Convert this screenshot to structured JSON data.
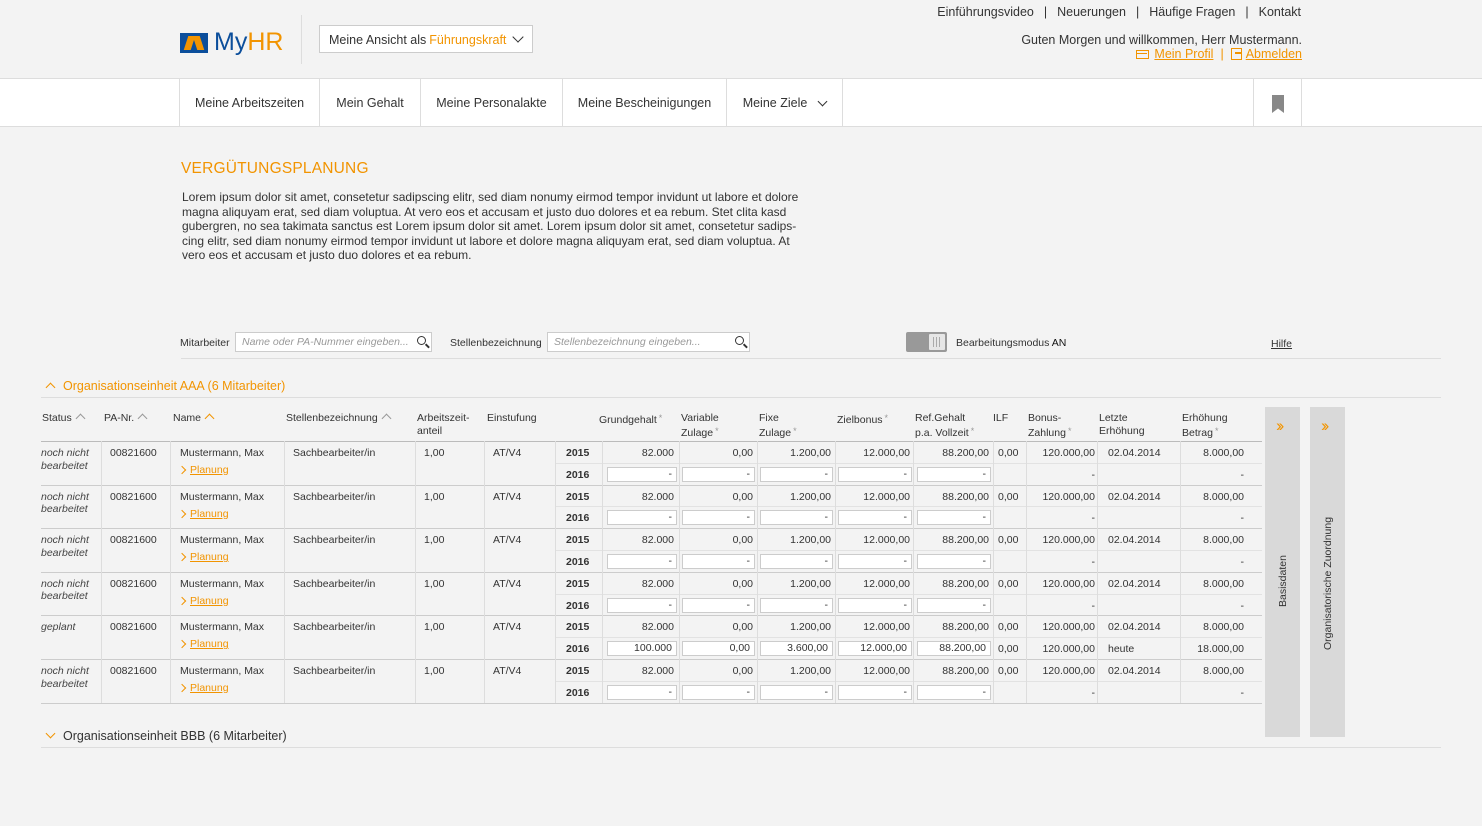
{
  "header": {
    "logo_text_my": "My",
    "logo_text_hr": "HR",
    "view_label": "Meine Ansicht als",
    "view_value": "Führungskraft",
    "top_links": [
      "Einführungsvideo",
      "Neuerungen",
      "Häufige Fragen",
      "Kontakt"
    ],
    "greeting": "Guten Morgen und willkommen, Herr Mustermann.",
    "profile_link": "Mein Profil",
    "logout_link": "Abmelden"
  },
  "nav": {
    "items": [
      "Meine Arbeitszeiten",
      "Mein Gehalt",
      "Meine Personalakte",
      "Meine Bescheinigungen",
      "Meine Ziele"
    ]
  },
  "page": {
    "title": "VERGÜTUNGSPLANUNG",
    "intro_lines": [
      "Lorem ipsum dolor sit amet, consetetur sadipscing elitr, sed diam nonumy eirmod tempor invidunt ut labore et dolore",
      "magna aliquyam erat, sed diam voluptua. At vero eos et accusam et justo duo dolores et ea rebum. Stet clita kasd",
      "gubergren, no sea takimata sanctus est Lorem ipsum dolor sit amet. Lorem ipsum dolor sit amet, consetetur sadips-",
      "cing elitr, sed diam nonumy eirmod tempor invidunt ut labore et dolore magna aliquyam erat, sed diam voluptua. At",
      "vero eos et accusam et justo duo dolores et ea rebum."
    ]
  },
  "filter": {
    "employee_label": "Mitarbeiter",
    "employee_placeholder": "Name oder PA-Nummer eingeben...",
    "position_label": "Stellenbezeichnung",
    "position_placeholder": "Stellenbezeichnung eingeben...",
    "edit_mode_label": "Bearbeitungsmodus",
    "edit_mode_value": "AN",
    "help_link": "Hilfe"
  },
  "org_units": [
    {
      "label": "Organisationseinheit AAA (6 Mitarbeiter)",
      "expanded": true
    },
    {
      "label": "Organisationseinheit BBB (6 Mitarbeiter)",
      "expanded": false
    }
  ],
  "table": {
    "columns": {
      "status": "Status",
      "pa_nr": "PA-Nr.",
      "name": "Name",
      "position": "Stellenbezeichnung",
      "work_share_1": "Arbeitszeit-",
      "work_share_2": "anteil",
      "grade": "Einstufung",
      "base_salary": "Grundgehalt",
      "variable_1": "Variable",
      "variable_2": "Zulage",
      "fixed_1": "Fixe",
      "fixed_2": "Zulage",
      "target_bonus": "Zielbonus",
      "ref_1": "Ref.Gehalt",
      "ref_2": "p.a. Vollzeit",
      "ilf": "ILF",
      "bonus_1": "Bonus-",
      "bonus_2": "Zahlung",
      "last_1": "Letzte",
      "last_2": "Erhöhung",
      "incr_1": "Erhöhung",
      "incr_2": "Betrag",
      "required_mark": "*"
    },
    "plan_link": "Planung",
    "rows": [
      {
        "status": "noch nicht bearbeitet",
        "pa_nr": "00821600",
        "name": "Mustermann, Max",
        "position": "Sachbearbeiter/in",
        "work_share": "1,00",
        "grade": "AT/V4",
        "y1": {
          "year": "2015",
          "base": "82.000",
          "var": "0,00",
          "fix": "1.200,00",
          "bonus": "12.000,00",
          "ref": "88.200,00",
          "ilf": "0,00",
          "payout": "120.000,00",
          "last": "02.04.2014",
          "incr": "8.000,00"
        },
        "y2": {
          "year": "2016",
          "base": "-",
          "var": "-",
          "fix": "-",
          "bonus": "-",
          "ref": "-",
          "ilf": "",
          "payout": "-",
          "last": "",
          "incr": "-"
        }
      },
      {
        "status": "noch nicht bearbeitet",
        "pa_nr": "00821600",
        "name": "Mustermann, Max",
        "position": "Sachbearbeiter/in",
        "work_share": "1,00",
        "grade": "AT/V4",
        "y1": {
          "year": "2015",
          "base": "82.000",
          "var": "0,00",
          "fix": "1.200,00",
          "bonus": "12.000,00",
          "ref": "88.200,00",
          "ilf": "0,00",
          "payout": "120.000,00",
          "last": "02.04.2014",
          "incr": "8.000,00"
        },
        "y2": {
          "year": "2016",
          "base": "-",
          "var": "-",
          "fix": "-",
          "bonus": "-",
          "ref": "-",
          "ilf": "",
          "payout": "-",
          "last": "",
          "incr": "-"
        }
      },
      {
        "status": "noch nicht bearbeitet",
        "pa_nr": "00821600",
        "name": "Mustermann, Max",
        "position": "Sachbearbeiter/in",
        "work_share": "1,00",
        "grade": "AT/V4",
        "y1": {
          "year": "2015",
          "base": "82.000",
          "var": "0,00",
          "fix": "1.200,00",
          "bonus": "12.000,00",
          "ref": "88.200,00",
          "ilf": "0,00",
          "payout": "120.000,00",
          "last": "02.04.2014",
          "incr": "8.000,00"
        },
        "y2": {
          "year": "2016",
          "base": "-",
          "var": "-",
          "fix": "-",
          "bonus": "-",
          "ref": "-",
          "ilf": "",
          "payout": "-",
          "last": "",
          "incr": "-"
        }
      },
      {
        "status": "noch nicht bearbeitet",
        "pa_nr": "00821600",
        "name": "Mustermann, Max",
        "position": "Sachbearbeiter/in",
        "work_share": "1,00",
        "grade": "AT/V4",
        "y1": {
          "year": "2015",
          "base": "82.000",
          "var": "0,00",
          "fix": "1.200,00",
          "bonus": "12.000,00",
          "ref": "88.200,00",
          "ilf": "0,00",
          "payout": "120.000,00",
          "last": "02.04.2014",
          "incr": "8.000,00"
        },
        "y2": {
          "year": "2016",
          "base": "-",
          "var": "-",
          "fix": "-",
          "bonus": "-",
          "ref": "-",
          "ilf": "",
          "payout": "-",
          "last": "",
          "incr": "-"
        }
      },
      {
        "status": "geplant",
        "pa_nr": "00821600",
        "name": "Mustermann, Max",
        "position": "Sachbearbeiter/in",
        "work_share": "1,00",
        "grade": "AT/V4",
        "y1": {
          "year": "2015",
          "base": "82.000",
          "var": "0,00",
          "fix": "1.200,00",
          "bonus": "12.000,00",
          "ref": "88.200,00",
          "ilf": "0,00",
          "payout": "120.000,00",
          "last": "02.04.2014",
          "incr": "8.000,00"
        },
        "y2": {
          "year": "2016",
          "base": "100.000",
          "var": "0,00",
          "fix": "3.600,00",
          "bonus": "12.000,00",
          "ref": "88.200,00",
          "ilf": "0,00",
          "payout": "120.000,00",
          "last": "heute",
          "incr": "18.000,00"
        }
      },
      {
        "status": "noch nicht bearbeitet",
        "pa_nr": "00821600",
        "name": "Mustermann, Max",
        "position": "Sachbearbeiter/in",
        "work_share": "1,00",
        "grade": "AT/V4",
        "y1": {
          "year": "2015",
          "base": "82.000",
          "var": "0,00",
          "fix": "1.200,00",
          "bonus": "12.000,00",
          "ref": "88.200,00",
          "ilf": "0,00",
          "payout": "120.000,00",
          "last": "02.04.2014",
          "incr": "8.000,00"
        },
        "y2": {
          "year": "2016",
          "base": "-",
          "var": "-",
          "fix": "-",
          "bonus": "-",
          "ref": "-",
          "ilf": "",
          "payout": "-",
          "last": "",
          "incr": "-"
        }
      }
    ]
  },
  "side_panels": {
    "panel1": {
      "label": "Basisdaten",
      "icon": "double-chevron-right-icon"
    },
    "panel2": {
      "label": "Organisatorische Zuordnung",
      "icon": "double-chevron-right-icon"
    }
  },
  "colors": {
    "accent": "#f29400",
    "brand_blue": "#0b4e9b"
  }
}
